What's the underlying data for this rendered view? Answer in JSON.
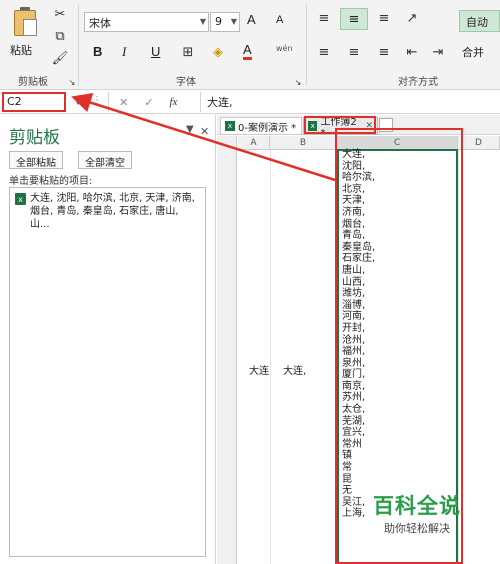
{
  "ribbon": {
    "paste_label": "粘贴",
    "clipboard_group": "剪贴板",
    "font_group": "字体",
    "align_group": "对齐方式",
    "font_name": "宋体",
    "font_size": "9",
    "bold": "B",
    "italic": "I",
    "underline": "U",
    "grow_font": "A",
    "shrink_font": "A",
    "font_color": "A",
    "wen": "wén",
    "right_btn": "合并",
    "right_top_btn": "自动"
  },
  "formula_bar": {
    "name_box": "C2",
    "fx": "fx",
    "formula": "大连,"
  },
  "clipboard_pane": {
    "title": "剪贴板",
    "paste_all": "全部粘贴",
    "clear_all": "全部清空",
    "hint": "单击要粘贴的项目:",
    "item_text": "大连, 沈阳, 哈尔滨, 北京, 天津, 济南, 烟台, 青岛, 秦皇岛, 石家庄, 唐山, 山..."
  },
  "tabs": [
    {
      "label": "0-案例演示 *"
    },
    {
      "label": "工作簿2 *"
    }
  ],
  "columns": [
    "A",
    "B",
    "C",
    "D"
  ],
  "cells": {
    "a": "大连",
    "b": "大连,",
    "c": "大连,\n沈阳,\n哈尔滨,\n北京,\n天津,\n济南,\n烟台,\n青岛,\n秦皇岛,\n石家庄,\n唐山,\n山西,\n潍坊,\n淄博,\n河南,\n开封,\n沧州,\n福州,\n泉州,\n厦门,\n南京,\n苏州,\n太仓,\n芜湖,\n宜兴,\n常州\n镇\n常\n昆\n无\n吴江,\n上海,"
  },
  "watermark": {
    "title": "百科全说",
    "subtitle": "助你轻松解决"
  },
  "colors": {
    "excel_green": "#217346",
    "highlight_red": "#e0302a"
  }
}
